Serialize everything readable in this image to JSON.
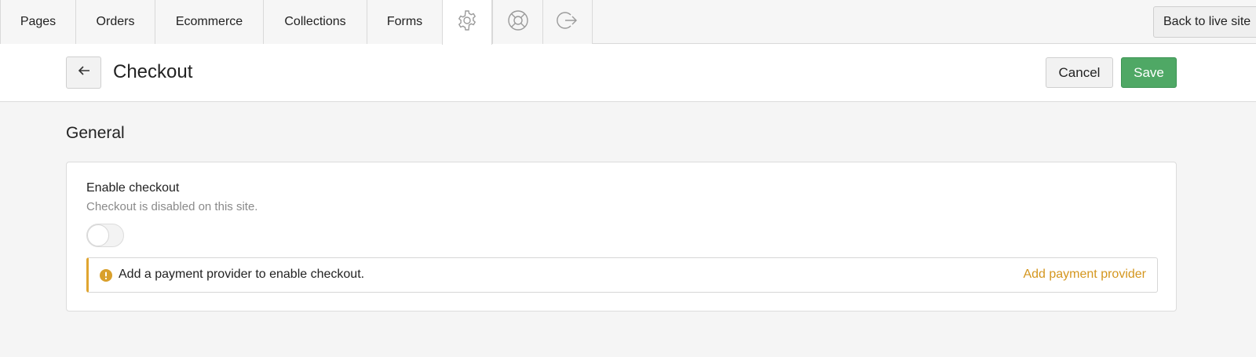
{
  "topnav": {
    "tabs": [
      {
        "label": "Pages"
      },
      {
        "label": "Orders"
      },
      {
        "label": "Ecommerce"
      },
      {
        "label": "Collections"
      },
      {
        "label": "Forms"
      }
    ],
    "icon_tabs": [
      {
        "icon": "gear-icon",
        "active": true
      },
      {
        "icon": "lifebuoy-icon",
        "active": false
      },
      {
        "icon": "logout-icon",
        "active": false
      }
    ],
    "back_to_live_label": "Back to live site"
  },
  "header": {
    "back_icon": "arrow-left-icon",
    "title": "Checkout",
    "cancel_label": "Cancel",
    "save_label": "Save"
  },
  "section": {
    "title": "General",
    "setting": {
      "label": "Enable checkout",
      "description": "Checkout is disabled on this site.",
      "enabled": false
    },
    "alert": {
      "icon": "warning-icon",
      "text": "Add a payment provider to enable checkout.",
      "link_label": "Add payment provider"
    }
  },
  "colors": {
    "save_green": "#4fa865",
    "warning_accent": "#e0a530",
    "link_orange": "#d4961e"
  }
}
